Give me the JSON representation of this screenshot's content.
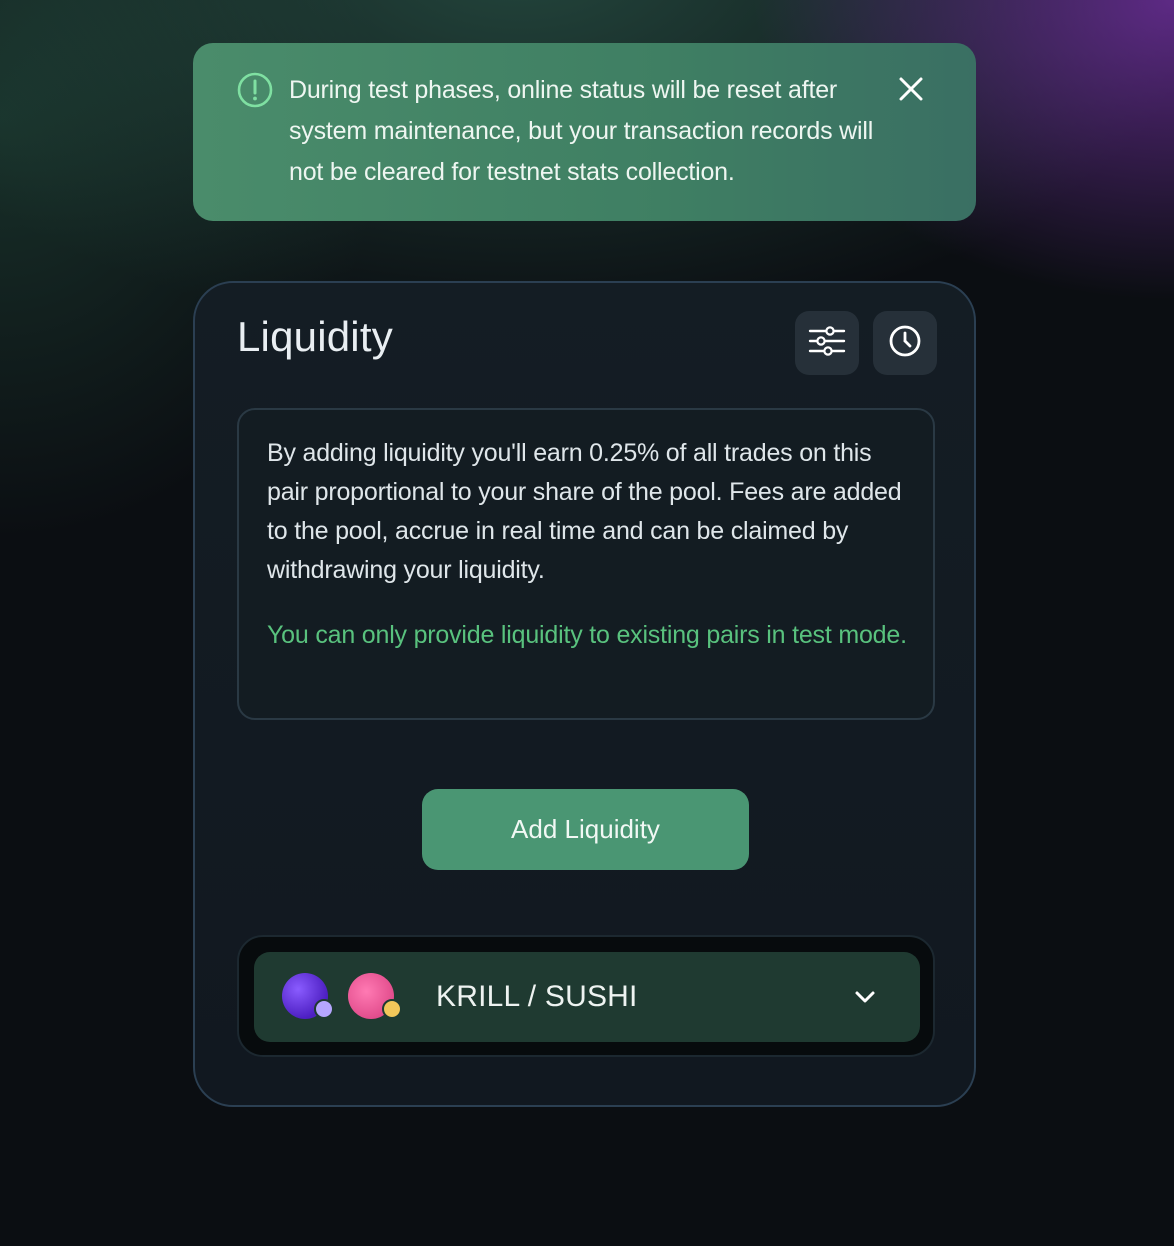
{
  "banner": {
    "message": "During test phases, online status will be reset after system maintenance, but your transaction records will not be cleared for testnet stats collection.",
    "icon": "alert-circle-icon",
    "close_icon": "close-icon"
  },
  "card": {
    "title": "Liquidity",
    "settings_icon": "sliders-icon",
    "history_icon": "clock-icon",
    "info_text": "By adding liquidity you'll earn 0.25% of all trades on this pair proportional to your share of the pool. Fees are added to the pool, accrue in real time and can be claimed by withdrawing your liquidity.",
    "info_note": "You can only provide liquidity to existing pairs in test mode.",
    "add_button_label": "Add Liquidity",
    "pair": {
      "label": "KRILL / SUSHI",
      "token_a": "KRILL",
      "token_b": "SUSHI"
    }
  },
  "colors": {
    "accent_green": "#4a9673",
    "note_green": "#59c27e",
    "banner_green": "#4a8c6b",
    "card_bg": "#141d24"
  }
}
